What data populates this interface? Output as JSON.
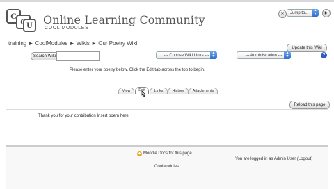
{
  "site": {
    "logo_letters": [
      "C",
      "C",
      "U"
    ],
    "title": "Online Learning Community",
    "subtitle": "COOL MODULES"
  },
  "jump": {
    "selected": "Jump to..."
  },
  "breadcrumb": [
    "training",
    "CoolModules",
    "Wikis",
    "Our Poetry Wiki"
  ],
  "breadcrumb_separator": "►",
  "buttons": {
    "update_wiki": "Update this Wiki",
    "reload": "Reload this page"
  },
  "search": {
    "label": "Search Wiki:",
    "value": ""
  },
  "wiki_links": {
    "selected": "--- Choose Wiki Links ---"
  },
  "administration": {
    "selected": "--- Administration ---"
  },
  "help_icon_glyph": "?",
  "intro_text": "Please enter your poetry below. Click the Edit tab across the top to begin.",
  "tabs": [
    {
      "label": "View",
      "active": false
    },
    {
      "label": "Edit",
      "active": true
    },
    {
      "label": "Links",
      "active": false
    },
    {
      "label": "History",
      "active": false
    },
    {
      "label": "Attachments",
      "active": false
    }
  ],
  "content_text": "Thank you for your contribution Insert poem here",
  "footer": {
    "moodle_docs": "Moodle Docs for this page",
    "login_prefix": "You are logged in as",
    "user": "Admin User",
    "logout": "(Logout)",
    "course": "CoolModules"
  },
  "colors": {
    "help_icon": "#2f5cbf",
    "select_arrows": "#2f6fd0"
  }
}
